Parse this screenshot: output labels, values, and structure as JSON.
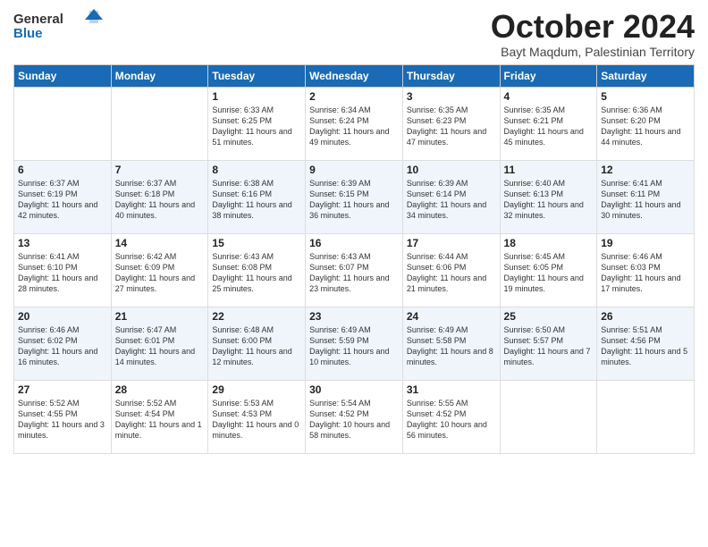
{
  "logo": {
    "general": "General",
    "blue": "Blue"
  },
  "header": {
    "month": "October 2024",
    "subtitle": "Bayt Maqdum, Palestinian Territory"
  },
  "weekdays": [
    "Sunday",
    "Monday",
    "Tuesday",
    "Wednesday",
    "Thursday",
    "Friday",
    "Saturday"
  ],
  "weeks": [
    [
      {
        "day": "",
        "info": ""
      },
      {
        "day": "",
        "info": ""
      },
      {
        "day": "1",
        "info": "Sunrise: 6:33 AM\nSunset: 6:25 PM\nDaylight: 11 hours and 51 minutes."
      },
      {
        "day": "2",
        "info": "Sunrise: 6:34 AM\nSunset: 6:24 PM\nDaylight: 11 hours and 49 minutes."
      },
      {
        "day": "3",
        "info": "Sunrise: 6:35 AM\nSunset: 6:23 PM\nDaylight: 11 hours and 47 minutes."
      },
      {
        "day": "4",
        "info": "Sunrise: 6:35 AM\nSunset: 6:21 PM\nDaylight: 11 hours and 45 minutes."
      },
      {
        "day": "5",
        "info": "Sunrise: 6:36 AM\nSunset: 6:20 PM\nDaylight: 11 hours and 44 minutes."
      }
    ],
    [
      {
        "day": "6",
        "info": "Sunrise: 6:37 AM\nSunset: 6:19 PM\nDaylight: 11 hours and 42 minutes."
      },
      {
        "day": "7",
        "info": "Sunrise: 6:37 AM\nSunset: 6:18 PM\nDaylight: 11 hours and 40 minutes."
      },
      {
        "day": "8",
        "info": "Sunrise: 6:38 AM\nSunset: 6:16 PM\nDaylight: 11 hours and 38 minutes."
      },
      {
        "day": "9",
        "info": "Sunrise: 6:39 AM\nSunset: 6:15 PM\nDaylight: 11 hours and 36 minutes."
      },
      {
        "day": "10",
        "info": "Sunrise: 6:39 AM\nSunset: 6:14 PM\nDaylight: 11 hours and 34 minutes."
      },
      {
        "day": "11",
        "info": "Sunrise: 6:40 AM\nSunset: 6:13 PM\nDaylight: 11 hours and 32 minutes."
      },
      {
        "day": "12",
        "info": "Sunrise: 6:41 AM\nSunset: 6:11 PM\nDaylight: 11 hours and 30 minutes."
      }
    ],
    [
      {
        "day": "13",
        "info": "Sunrise: 6:41 AM\nSunset: 6:10 PM\nDaylight: 11 hours and 28 minutes."
      },
      {
        "day": "14",
        "info": "Sunrise: 6:42 AM\nSunset: 6:09 PM\nDaylight: 11 hours and 27 minutes."
      },
      {
        "day": "15",
        "info": "Sunrise: 6:43 AM\nSunset: 6:08 PM\nDaylight: 11 hours and 25 minutes."
      },
      {
        "day": "16",
        "info": "Sunrise: 6:43 AM\nSunset: 6:07 PM\nDaylight: 11 hours and 23 minutes."
      },
      {
        "day": "17",
        "info": "Sunrise: 6:44 AM\nSunset: 6:06 PM\nDaylight: 11 hours and 21 minutes."
      },
      {
        "day": "18",
        "info": "Sunrise: 6:45 AM\nSunset: 6:05 PM\nDaylight: 11 hours and 19 minutes."
      },
      {
        "day": "19",
        "info": "Sunrise: 6:46 AM\nSunset: 6:03 PM\nDaylight: 11 hours and 17 minutes."
      }
    ],
    [
      {
        "day": "20",
        "info": "Sunrise: 6:46 AM\nSunset: 6:02 PM\nDaylight: 11 hours and 16 minutes."
      },
      {
        "day": "21",
        "info": "Sunrise: 6:47 AM\nSunset: 6:01 PM\nDaylight: 11 hours and 14 minutes."
      },
      {
        "day": "22",
        "info": "Sunrise: 6:48 AM\nSunset: 6:00 PM\nDaylight: 11 hours and 12 minutes."
      },
      {
        "day": "23",
        "info": "Sunrise: 6:49 AM\nSunset: 5:59 PM\nDaylight: 11 hours and 10 minutes."
      },
      {
        "day": "24",
        "info": "Sunrise: 6:49 AM\nSunset: 5:58 PM\nDaylight: 11 hours and 8 minutes."
      },
      {
        "day": "25",
        "info": "Sunrise: 6:50 AM\nSunset: 5:57 PM\nDaylight: 11 hours and 7 minutes."
      },
      {
        "day": "26",
        "info": "Sunrise: 5:51 AM\nSunset: 4:56 PM\nDaylight: 11 hours and 5 minutes."
      }
    ],
    [
      {
        "day": "27",
        "info": "Sunrise: 5:52 AM\nSunset: 4:55 PM\nDaylight: 11 hours and 3 minutes."
      },
      {
        "day": "28",
        "info": "Sunrise: 5:52 AM\nSunset: 4:54 PM\nDaylight: 11 hours and 1 minute."
      },
      {
        "day": "29",
        "info": "Sunrise: 5:53 AM\nSunset: 4:53 PM\nDaylight: 11 hours and 0 minutes."
      },
      {
        "day": "30",
        "info": "Sunrise: 5:54 AM\nSunset: 4:52 PM\nDaylight: 10 hours and 58 minutes."
      },
      {
        "day": "31",
        "info": "Sunrise: 5:55 AM\nSunset: 4:52 PM\nDaylight: 10 hours and 56 minutes."
      },
      {
        "day": "",
        "info": ""
      },
      {
        "day": "",
        "info": ""
      }
    ]
  ]
}
